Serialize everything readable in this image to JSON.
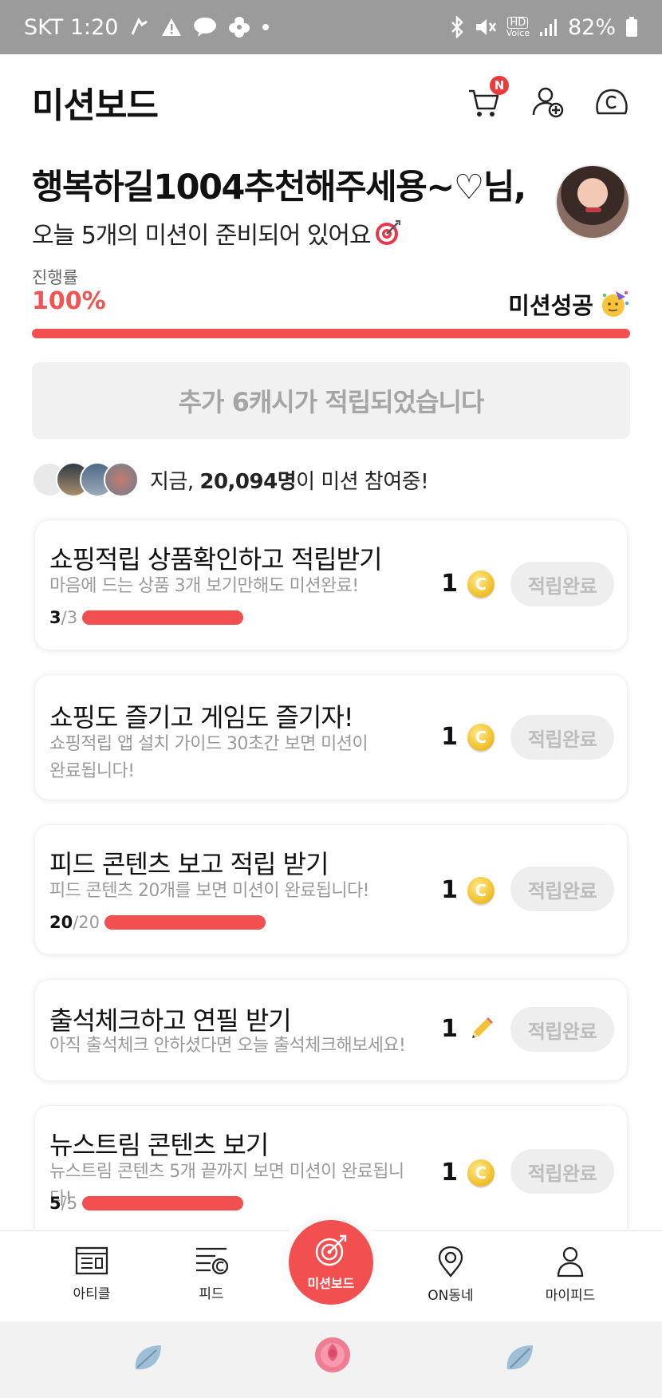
{
  "status_bar": {
    "carrier_time": "SKT 1:20",
    "volte_label": "Voice",
    "hd_label": "HD",
    "battery": "82%",
    "icons": [
      "signature-icon",
      "alert-icon",
      "talk-icon",
      "flower-icon",
      "dot-icon",
      "bluetooth-icon",
      "mute-icon",
      "signal-icon",
      "battery-icon"
    ]
  },
  "header": {
    "title": "미션보드",
    "cart_badge": "N",
    "icons": [
      "cart-icon",
      "add-friend-icon",
      "cash-icon"
    ]
  },
  "greeting": {
    "name": "행복하길1004추천해주세용~♡님,",
    "subtitle": "오늘 5개의 미션이 준비되어 있어요"
  },
  "progress": {
    "label": "진행률",
    "value_text": "100%",
    "value": 1.0,
    "status": "미션성공"
  },
  "banner": {
    "text": "추가 6캐시가 적립되었습니다"
  },
  "participants": {
    "prefix": "지금,",
    "count": "20,094명",
    "suffix": "이 미션 참여중!"
  },
  "missions": [
    {
      "title": "쇼핑적립 상품확인하고 적립받기",
      "desc": "마음에 드는 상품 3개 보기만해도 미션완료!",
      "progress_current": "3",
      "progress_total": "/3",
      "progress_fraction": 1.0,
      "reward": "1",
      "reward_icon": "coin-icon",
      "button": "적립완료"
    },
    {
      "title": "쇼핑도 즐기고 게임도 즐기자!",
      "desc": "쇼핑적립 앱 설치 가이드 30초간 보면 미션이 완료됩니다!",
      "reward": "1",
      "reward_icon": "coin-icon",
      "button": "적립완료"
    },
    {
      "title": "피드 콘텐츠 보고 적립 받기",
      "desc": "피드 콘텐츠 20개를 보면 미션이 완료됩니다!",
      "progress_current": "20",
      "progress_total": "/20",
      "progress_fraction": 1.0,
      "reward": "1",
      "reward_icon": "coin-icon",
      "button": "적립완료"
    },
    {
      "title": "출석체크하고 연필 받기",
      "desc": "아직 출석체크 안하셨다면 오늘 출석체크해보세요!",
      "reward": "1",
      "reward_icon": "pencil-icon",
      "button": "적립완료"
    },
    {
      "title": "뉴스트림 콘텐츠 보기",
      "desc": "뉴스트림 콘텐츠 5개 끝까지 보면 미션이 완료됩니다!",
      "progress_current": "5",
      "progress_total": "/5",
      "progress_fraction": 1.0,
      "reward": "1",
      "reward_icon": "coin-icon",
      "button": "적립완료"
    }
  ],
  "bottom_nav": [
    {
      "label": "아티클",
      "icon": "article-icon"
    },
    {
      "label": "피드",
      "icon": "feed-icon"
    },
    {
      "label": "미션보드",
      "icon": "target-icon",
      "active": true
    },
    {
      "label": "ON동네",
      "icon": "location-icon"
    },
    {
      "label": "마이피드",
      "icon": "profile-icon"
    }
  ],
  "colors": {
    "accent": "#f25050",
    "status_bar": "#9b9b9b",
    "coin": "#f2c230"
  }
}
